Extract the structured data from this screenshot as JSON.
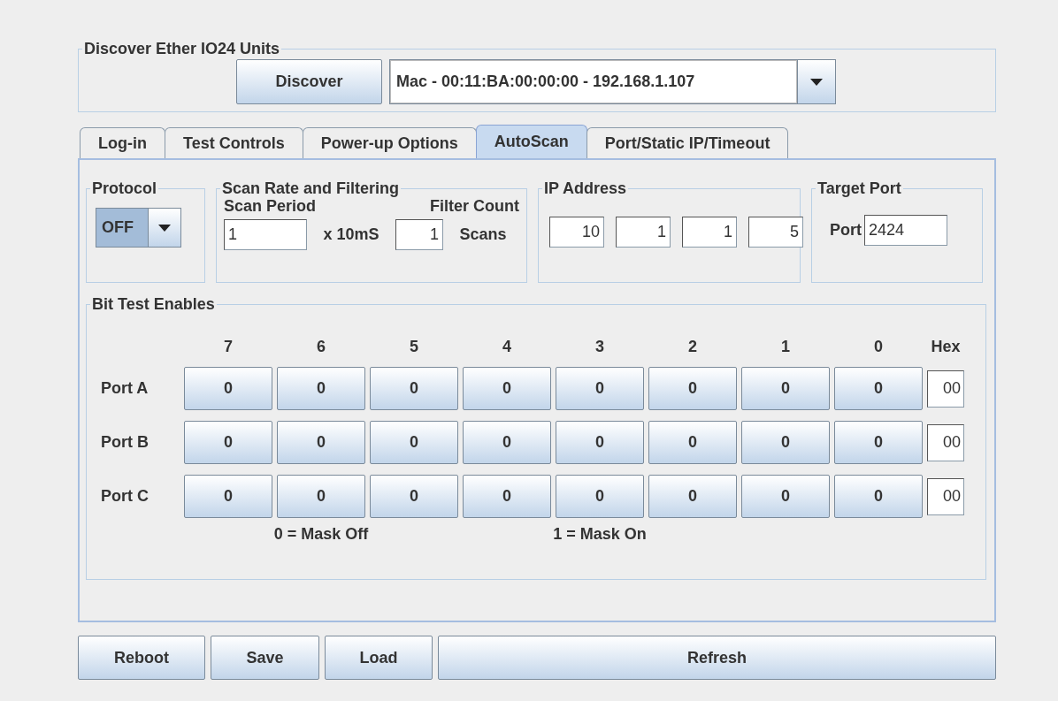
{
  "discover": {
    "title": "Discover Ether IO24 Units",
    "button": "Discover",
    "device": "Mac - 00:11:BA:00:00:00 - 192.168.1.107"
  },
  "tabs": [
    {
      "label": "Log-in",
      "selected": false
    },
    {
      "label": "Test Controls",
      "selected": false
    },
    {
      "label": "Power-up Options",
      "selected": false
    },
    {
      "label": "AutoScan",
      "selected": true
    },
    {
      "label": "Port/Static IP/Timeout",
      "selected": false
    }
  ],
  "protocol": {
    "title": "Protocol",
    "value": "OFF"
  },
  "scan": {
    "title": "Scan Rate and Filtering",
    "period_label": "Scan Period",
    "period": "1",
    "period_unit": "x 10mS",
    "filter_label": "Filter Count",
    "filter": "1",
    "filter_unit": "Scans"
  },
  "ip": {
    "title": "IP Address",
    "octets": [
      "10",
      "1",
      "1",
      "5"
    ]
  },
  "target_port": {
    "title": "Target Port",
    "label": "Port",
    "value": "2424"
  },
  "bits": {
    "title": "Bit Test Enables",
    "columns": [
      "7",
      "6",
      "5",
      "4",
      "3",
      "2",
      "1",
      "0"
    ],
    "hex_label": "Hex",
    "rows": [
      {
        "label": "Port A",
        "bits": [
          "0",
          "0",
          "0",
          "0",
          "0",
          "0",
          "0",
          "0"
        ],
        "hex": "00"
      },
      {
        "label": "Port B",
        "bits": [
          "0",
          "0",
          "0",
          "0",
          "0",
          "0",
          "0",
          "0"
        ],
        "hex": "00"
      },
      {
        "label": "Port C",
        "bits": [
          "0",
          "0",
          "0",
          "0",
          "0",
          "0",
          "0",
          "0"
        ],
        "hex": "00"
      }
    ],
    "legend": [
      "0 = Mask Off",
      "1 = Mask On"
    ]
  },
  "buttons": [
    "Reboot",
    "Save",
    "Load",
    "Refresh"
  ]
}
